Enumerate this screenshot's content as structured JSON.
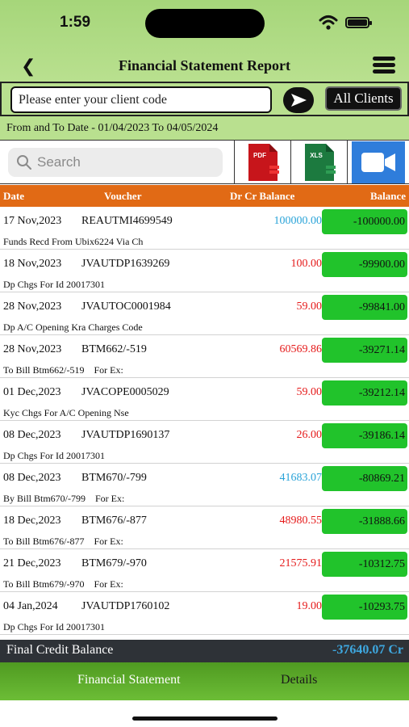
{
  "status_bar": {
    "time": "1:59"
  },
  "header": {
    "title": "Financial Statement Report"
  },
  "client": {
    "placeholder": "Please enter your client code",
    "all_clients_label": "All Clients"
  },
  "date_range": {
    "text": "From and To Date - 01/04/2023 To 04/05/2024"
  },
  "search": {
    "placeholder": "Search"
  },
  "export_icons": {
    "pdf_label": "PDF",
    "xls_label": "XLS"
  },
  "colors": {
    "credit": "#29a3d8",
    "debit": "#e51a1a",
    "balance_box": "#21c32b",
    "header_orange": "#e16a15"
  },
  "table": {
    "columns": {
      "date": "Date",
      "voucher": "Voucher",
      "drcr": "Dr Cr Balance",
      "balance": "Balance"
    },
    "rows": [
      {
        "date": "17 Nov,2023",
        "voucher": "REAUTMI4699549",
        "drcr": "100000.00",
        "type": "credit",
        "balance": "-100000.00",
        "narration": "Funds Recd From Ubix6224 Via Ch"
      },
      {
        "date": "18 Nov,2023",
        "voucher": "JVAUTDP1639269",
        "drcr": "100.00",
        "type": "debit",
        "balance": "-99900.00",
        "narration": "Dp Chgs For Id 20017301"
      },
      {
        "date": "28 Nov,2023",
        "voucher": "JVAUTOC0001984",
        "drcr": "59.00",
        "type": "debit",
        "balance": "-99841.00",
        "narration": "Dp A/C Opening Kra Charges Code"
      },
      {
        "date": "28 Nov,2023",
        "voucher": "BTM662/-519",
        "drcr": "60569.86",
        "type": "debit",
        "balance": "-39271.14",
        "narration": "To Bill Btm662/-519    For Ex:"
      },
      {
        "date": "01 Dec,2023",
        "voucher": "JVACOPE0005029",
        "drcr": "59.00",
        "type": "debit",
        "balance": "-39212.14",
        "narration": "Kyc Chgs For A/C Opening Nse"
      },
      {
        "date": "08 Dec,2023",
        "voucher": "JVAUTDP1690137",
        "drcr": "26.00",
        "type": "debit",
        "balance": "-39186.14",
        "narration": "Dp Chgs For Id 20017301"
      },
      {
        "date": "08 Dec,2023",
        "voucher": "BTM670/-799",
        "drcr": "41683.07",
        "type": "credit",
        "balance": "-80869.21",
        "narration": "By Bill Btm670/-799    For Ex:"
      },
      {
        "date": "18 Dec,2023",
        "voucher": "BTM676/-877",
        "drcr": "48980.55",
        "type": "debit",
        "balance": "-31888.66",
        "narration": "To Bill Btm676/-877    For Ex:"
      },
      {
        "date": "21 Dec,2023",
        "voucher": "BTM679/-970",
        "drcr": "21575.91",
        "type": "debit",
        "balance": "-10312.75",
        "narration": "To Bill Btm679/-970    For Ex:"
      },
      {
        "date": "04 Jan,2024",
        "voucher": "JVAUTDP1760102",
        "drcr": "19.00",
        "type": "debit",
        "balance": "-10293.75",
        "narration": "Dp Chgs For Id 20017301"
      }
    ]
  },
  "final": {
    "label": "Final Credit Balance",
    "value": "-37640.07 Cr"
  },
  "tabs": [
    {
      "label": "Financial Statement",
      "active": true
    },
    {
      "label": "Details",
      "active": false
    }
  ]
}
